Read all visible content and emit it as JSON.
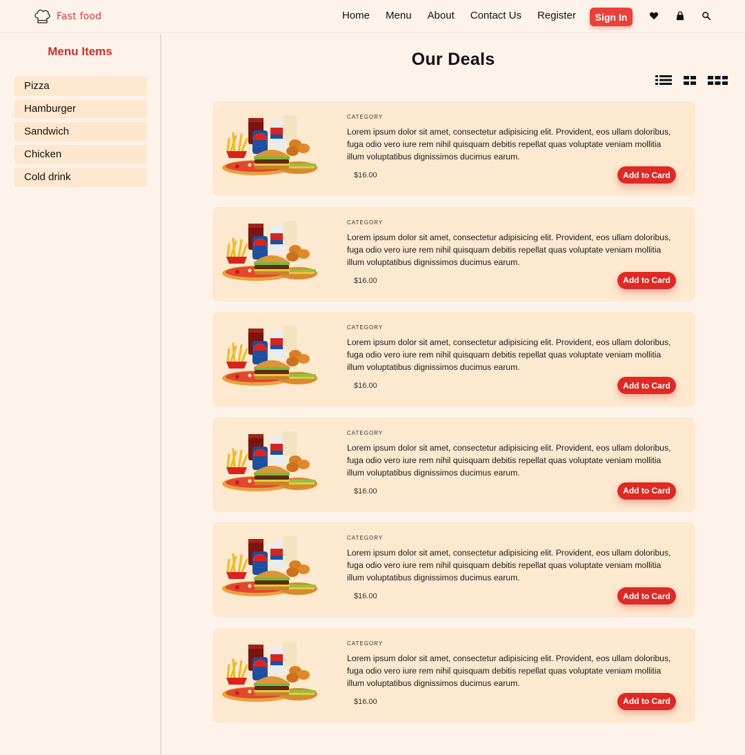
{
  "brand": {
    "name": "Fast food",
    "logo_icon": "chef-hat-icon"
  },
  "nav": {
    "links": [
      "Home",
      "Menu",
      "About",
      "Contact Us",
      "Register"
    ],
    "signin_label": "Sign In",
    "icons": [
      "heart-icon",
      "shopping-bag-icon",
      "search-icon"
    ]
  },
  "sidebar": {
    "title": "Menu Items",
    "items": [
      "Pizza",
      "Hamburger",
      "Sandwich",
      "Chicken",
      "Cold drink"
    ]
  },
  "main": {
    "title": "Our Deals",
    "view_toggles": [
      "list-view-icon",
      "grid-2-view-icon",
      "grid-3-view-icon"
    ],
    "deals": [
      {
        "category": "CATEGORY",
        "description": "Lorem ipsum dolor sit amet, consectetur adipisicing elit. Provident, eos ullam doloribus, fuga odio vero iure rem nihil quisquam debitis repellat quas voluptate veniam mollitia illum voluptatibus dignissimos ducimus earum.",
        "price": "$16.00",
        "button": "Add to Card"
      },
      {
        "category": "CATEGORY",
        "description": "Lorem ipsum dolor sit amet, consectetur adipisicing elit. Provident, eos ullam doloribus, fuga odio vero iure rem nihil quisquam debitis repellat quas voluptate veniam mollitia illum voluptatibus dignissimos ducimus earum.",
        "price": "$16.00",
        "button": "Add to Card"
      },
      {
        "category": "CATEGORY",
        "description": "Lorem ipsum dolor sit amet, consectetur adipisicing elit. Provident, eos ullam doloribus, fuga odio vero iure rem nihil quisquam debitis repellat quas voluptate veniam mollitia illum voluptatibus dignissimos ducimus earum.",
        "price": "$16.00",
        "button": "Add to Card"
      },
      {
        "category": "CATEGORY",
        "description": "Lorem ipsum dolor sit amet, consectetur adipisicing elit. Provident, eos ullam doloribus, fuga odio vero iure rem nihil quisquam debitis repellat quas voluptate veniam mollitia illum voluptatibus dignissimos ducimus earum.",
        "price": "$16.00",
        "button": "Add to Card"
      },
      {
        "category": "CATEGORY",
        "description": "Lorem ipsum dolor sit amet, consectetur adipisicing elit. Provident, eos ullam doloribus, fuga odio vero iure rem nihil quisquam debitis repellat quas voluptate veniam mollitia illum voluptatibus dignissimos ducimus earum.",
        "price": "$16.00",
        "button": "Add to Card"
      },
      {
        "category": "CATEGORY",
        "description": "Lorem ipsum dolor sit amet, consectetur adipisicing elit. Provident, eos ullam doloribus, fuga odio vero iure rem nihil quisquam debitis repellat quas voluptate veniam mollitia illum voluptatibus dignissimos ducimus earum.",
        "price": "$16.00",
        "button": "Add to Card"
      }
    ]
  },
  "colors": {
    "background": "#fdf3ea",
    "card": "#fde8d0",
    "accent": "#dd2a24",
    "brand_text": "#d23b36"
  }
}
